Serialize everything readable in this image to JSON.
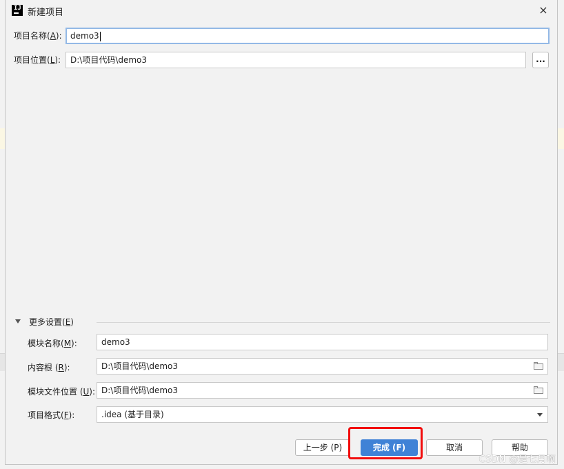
{
  "window": {
    "title": "新建项目",
    "close": "×",
    "app_icon_text": "IJ"
  },
  "project": {
    "name_label": "项目名称(",
    "name_key": "A",
    "name_suffix": "):",
    "name_value": "demo3",
    "location_label": "项目位置(",
    "location_key": "L",
    "location_suffix": "):",
    "location_value": "D:\\项目代码\\demo3",
    "browse_label": "..."
  },
  "more_settings": {
    "label": "更多设置(",
    "key": "E",
    "suffix": ")",
    "module_name_label": "模块名称(",
    "module_name_key": "M",
    "module_name_suffix": "):",
    "module_name_value": "demo3",
    "content_root_label": "内容根 (",
    "content_root_key": "R",
    "content_root_suffix": "):",
    "content_root_value": "D:\\项目代码\\demo3",
    "module_file_label": "模块文件位置 (",
    "module_file_key": "U",
    "module_file_suffix": "):",
    "module_file_value": "D:\\项目代码\\demo3",
    "format_label": "项目格式(",
    "format_key": "F",
    "format_suffix": "):",
    "format_value": ".idea (基于目录)"
  },
  "buttons": {
    "previous": "上一步 (P)",
    "finish": "完成 (F)",
    "cancel": "取消",
    "help": "帮助"
  },
  "watermark": "CSDN @是七月啊",
  "colors": {
    "primary": "#3f82d6",
    "highlight": "#f20d0d",
    "focus": "#93b9e6"
  }
}
